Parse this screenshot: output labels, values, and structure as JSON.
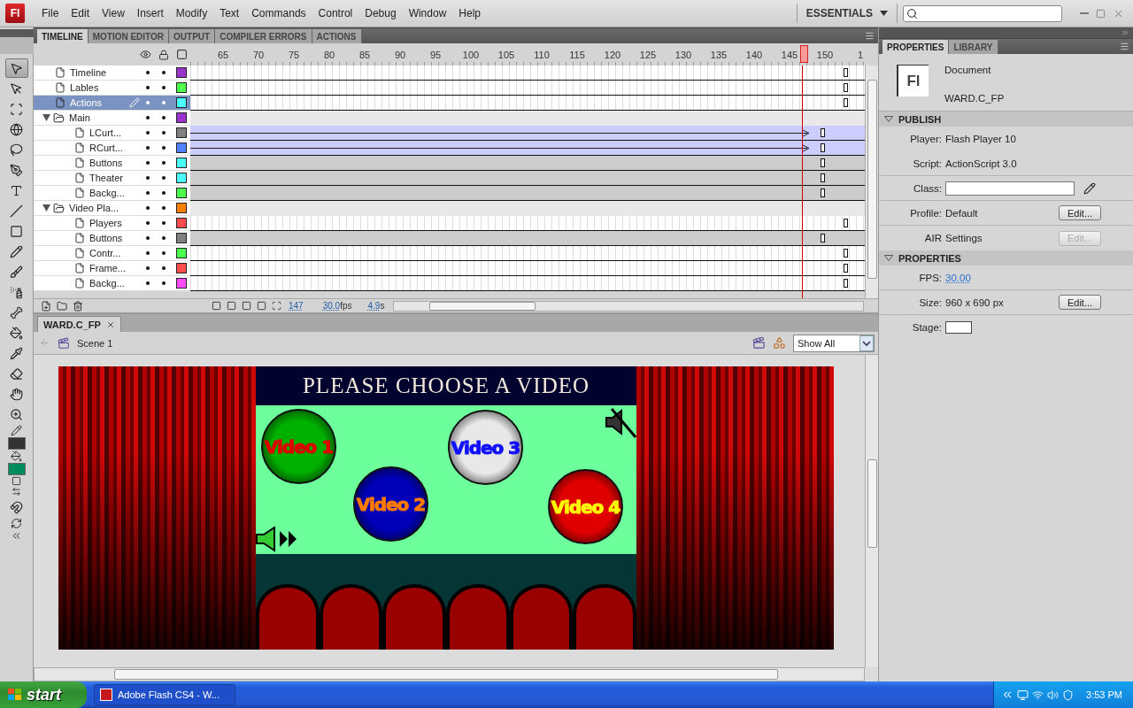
{
  "app": {
    "logo": "Fl"
  },
  "menu": [
    "File",
    "Edit",
    "View",
    "Insert",
    "Modify",
    "Text",
    "Commands",
    "Control",
    "Debug",
    "Window",
    "Help"
  ],
  "workspace": {
    "label": "ESSENTIALS"
  },
  "tools": [
    {
      "kind": "selection",
      "selected": true
    },
    {
      "kind": "subselection",
      "selected": false
    },
    {
      "kind": "transform",
      "selected": false
    },
    {
      "kind": "rotate3d",
      "selected": false
    },
    {
      "kind": "lasso",
      "selected": false
    },
    {
      "kind": "pen",
      "selected": false
    },
    {
      "kind": "text",
      "selected": false
    },
    {
      "kind": "line",
      "selected": false
    },
    {
      "kind": "rect",
      "selected": false
    },
    {
      "kind": "pencil",
      "selected": false
    },
    {
      "kind": "brush",
      "selected": false
    },
    {
      "kind": "deco",
      "selected": false
    },
    {
      "kind": "bone",
      "selected": false
    },
    {
      "kind": "bucket",
      "selected": false
    },
    {
      "kind": "eyedropper",
      "selected": false
    },
    {
      "kind": "eraser",
      "selected": false
    },
    {
      "kind": "hand",
      "selected": false
    },
    {
      "kind": "zoom",
      "selected": false
    }
  ],
  "swatches": [
    {
      "kind": "stroke",
      "color": "#333333"
    },
    {
      "kind": "fill",
      "color": "#008a5e"
    }
  ],
  "timeline": {
    "tabs": [
      {
        "label": "TIMELINE",
        "selected": true
      },
      {
        "label": "MOTION EDITOR",
        "selected": false
      },
      {
        "label": "OUTPUT",
        "selected": false
      },
      {
        "label": "COMPILER ERRORS",
        "selected": false
      },
      {
        "label": "ACTIONS",
        "selected": false
      }
    ],
    "ruler": [
      "65",
      "70",
      "75",
      "80",
      "85",
      "90",
      "95",
      "100",
      "105",
      "110",
      "115",
      "120",
      "125",
      "130",
      "135",
      "140",
      "145",
      "150",
      "1"
    ],
    "layers": [
      {
        "kind": "layer",
        "name": "Timeline",
        "color": "#9933cc",
        "selected": false,
        "tween": false,
        "shaded": false
      },
      {
        "kind": "layer",
        "name": "Lables",
        "color": "#4cff4c",
        "selected": false,
        "tween": false,
        "shaded": false
      },
      {
        "kind": "layer",
        "name": "Actions",
        "color": "#4cffff",
        "selected": true,
        "tween": false,
        "shaded": false
      },
      {
        "kind": "folder",
        "name": "Main",
        "color": "#9933cc",
        "selected": false,
        "expanded": true,
        "children": [
          {
            "kind": "layer",
            "name": "LCurt...",
            "color": "#808080",
            "selected": false,
            "tween": true,
            "shaded": true
          },
          {
            "kind": "layer",
            "name": "RCurt...",
            "color": "#4f80ff",
            "selected": false,
            "tween": true,
            "shaded": true
          },
          {
            "kind": "layer",
            "name": "Buttons",
            "color": "#4cffff",
            "selected": false,
            "tween": false,
            "shaded": true
          },
          {
            "kind": "layer",
            "name": "Theater",
            "color": "#4cffff",
            "selected": false,
            "tween": false,
            "shaded": true
          },
          {
            "kind": "layer",
            "name": "Backg...",
            "color": "#4cff4c",
            "selected": false,
            "tween": false,
            "shaded": true
          }
        ]
      },
      {
        "kind": "folder",
        "name": "Video Pla...",
        "color": "#ff8000",
        "selected": false,
        "expanded": true,
        "children": [
          {
            "kind": "layer",
            "name": "Players",
            "color": "#ff4c4c",
            "selected": false,
            "tween": false,
            "shaded": false
          },
          {
            "kind": "layer",
            "name": "Buttons",
            "color": "#808080",
            "selected": false,
            "tween": false,
            "shaded": true
          },
          {
            "kind": "layer",
            "name": "Contr...",
            "color": "#4cff4c",
            "selected": false,
            "tween": false,
            "shaded": false
          },
          {
            "kind": "layer",
            "name": "Frame...",
            "color": "#ff4c4c",
            "selected": false,
            "tween": false,
            "shaded": false
          },
          {
            "kind": "layer",
            "name": "Backg...",
            "color": "#ff4cff",
            "selected": false,
            "tween": false,
            "shaded": false
          }
        ]
      }
    ],
    "status": {
      "current_frame": "147",
      "frame_rate": "30.0",
      "rate_unit": "fps",
      "elapsed": "4.9",
      "elapsed_unit": "s"
    }
  },
  "document": {
    "tab": "WARD.C_FP",
    "scene": "Scene 1",
    "zoom": "Show All",
    "stage": {
      "title": "PLEASE CHOOSE A VIDEO",
      "videos": [
        {
          "color": "#00b000",
          "label": {
            "text": "Video 1",
            "color": "#e00000"
          }
        },
        {
          "color": "#0000b8",
          "label": {
            "text": "Video 2",
            "color": "#ff7a00"
          }
        },
        {
          "color": "#e8e8e8",
          "label": {
            "text": "Video 3",
            "color": "#1010ff"
          }
        },
        {
          "color": "#e00000",
          "label": {
            "text": "Video 4",
            "color": "#ffff00"
          }
        }
      ]
    }
  },
  "properties": {
    "tabs": [
      {
        "label": "PROPERTIES",
        "selected": true
      },
      {
        "label": "LIBRARY",
        "selected": false
      }
    ],
    "doc_icon": "Fl",
    "doc_type": "Document",
    "doc_name": "WARD.C_FP",
    "sections": [
      {
        "title": "PUBLISH",
        "expanded": true,
        "rows": [
          {
            "kind": "text",
            "label": "Player:",
            "value": "Flash Player 10"
          },
          {
            "kind": "text",
            "label": "Script:",
            "value": "ActionScript 3.0"
          },
          {
            "kind": "field",
            "label": "Class:"
          },
          {
            "kind": "text",
            "label": "Profile:",
            "value": "Default",
            "button": {
              "label": "Edit...",
              "disabled": false
            }
          },
          {
            "kind": "text",
            "label": "AIR",
            "value": "Settings",
            "button": {
              "label": "Edit...",
              "disabled": true
            }
          }
        ]
      },
      {
        "title": "PROPERTIES",
        "expanded": true,
        "rows": [
          {
            "kind": "link",
            "label": "FPS:",
            "value": "30.00"
          },
          {
            "kind": "text",
            "label": "Size:",
            "value": "960 x 690 px",
            "button": {
              "label": "Edit...",
              "disabled": false
            }
          },
          {
            "kind": "swatch",
            "label": "Stage:",
            "color": "#ffffff"
          }
        ]
      }
    ]
  },
  "taskbar": {
    "start": "start",
    "tasks": [
      "Adobe Flash CS4 - W..."
    ],
    "clock": "3:53 PM"
  }
}
